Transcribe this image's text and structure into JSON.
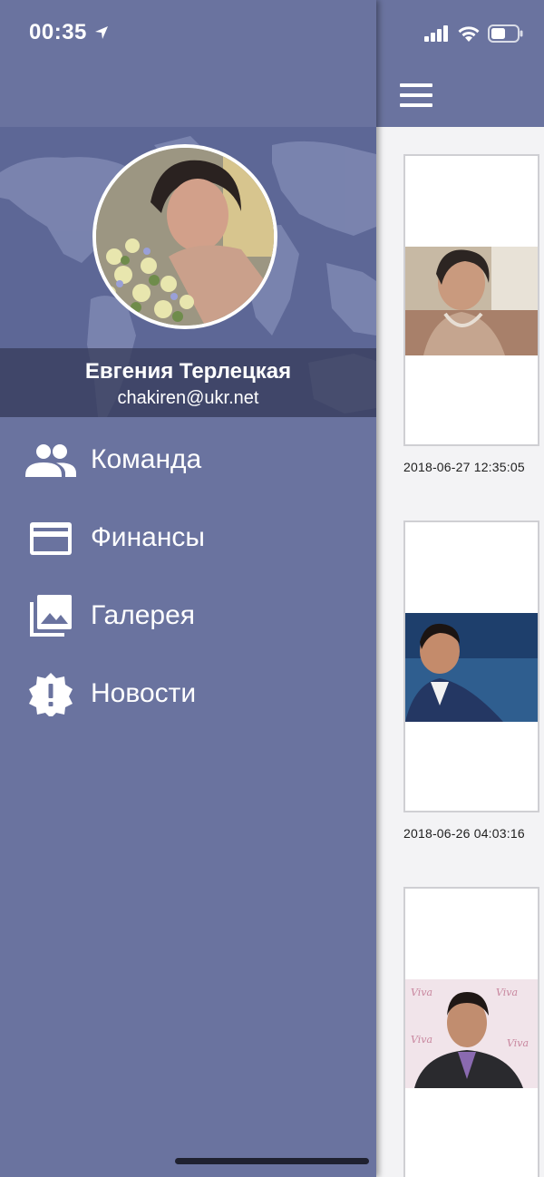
{
  "status_bar": {
    "time": "00:35",
    "location_icon": "location-arrow-icon",
    "signal_icon": "cellular-signal-icon",
    "wifi_icon": "wifi-icon",
    "battery_icon": "battery-icon"
  },
  "main": {
    "menu_icon": "hamburger-menu-icon",
    "gallery": [
      {
        "date": "2018-06-27 12:35:05"
      },
      {
        "date": "2018-06-26 04:03:16"
      },
      {
        "date": ""
      }
    ]
  },
  "drawer": {
    "profile": {
      "name": "Евгения Терлецкая",
      "email": "chakiren@ukr.net"
    },
    "menu": [
      {
        "label": "Команда",
        "icon": "team-icon"
      },
      {
        "label": "Финансы",
        "icon": "credit-card-icon"
      },
      {
        "label": "Галерея",
        "icon": "gallery-icon"
      },
      {
        "label": "Новости",
        "icon": "news-alert-icon"
      }
    ]
  },
  "colors": {
    "primary": "#6a739f",
    "header_band": "#383e5c",
    "content_bg": "#f3f3f5"
  }
}
